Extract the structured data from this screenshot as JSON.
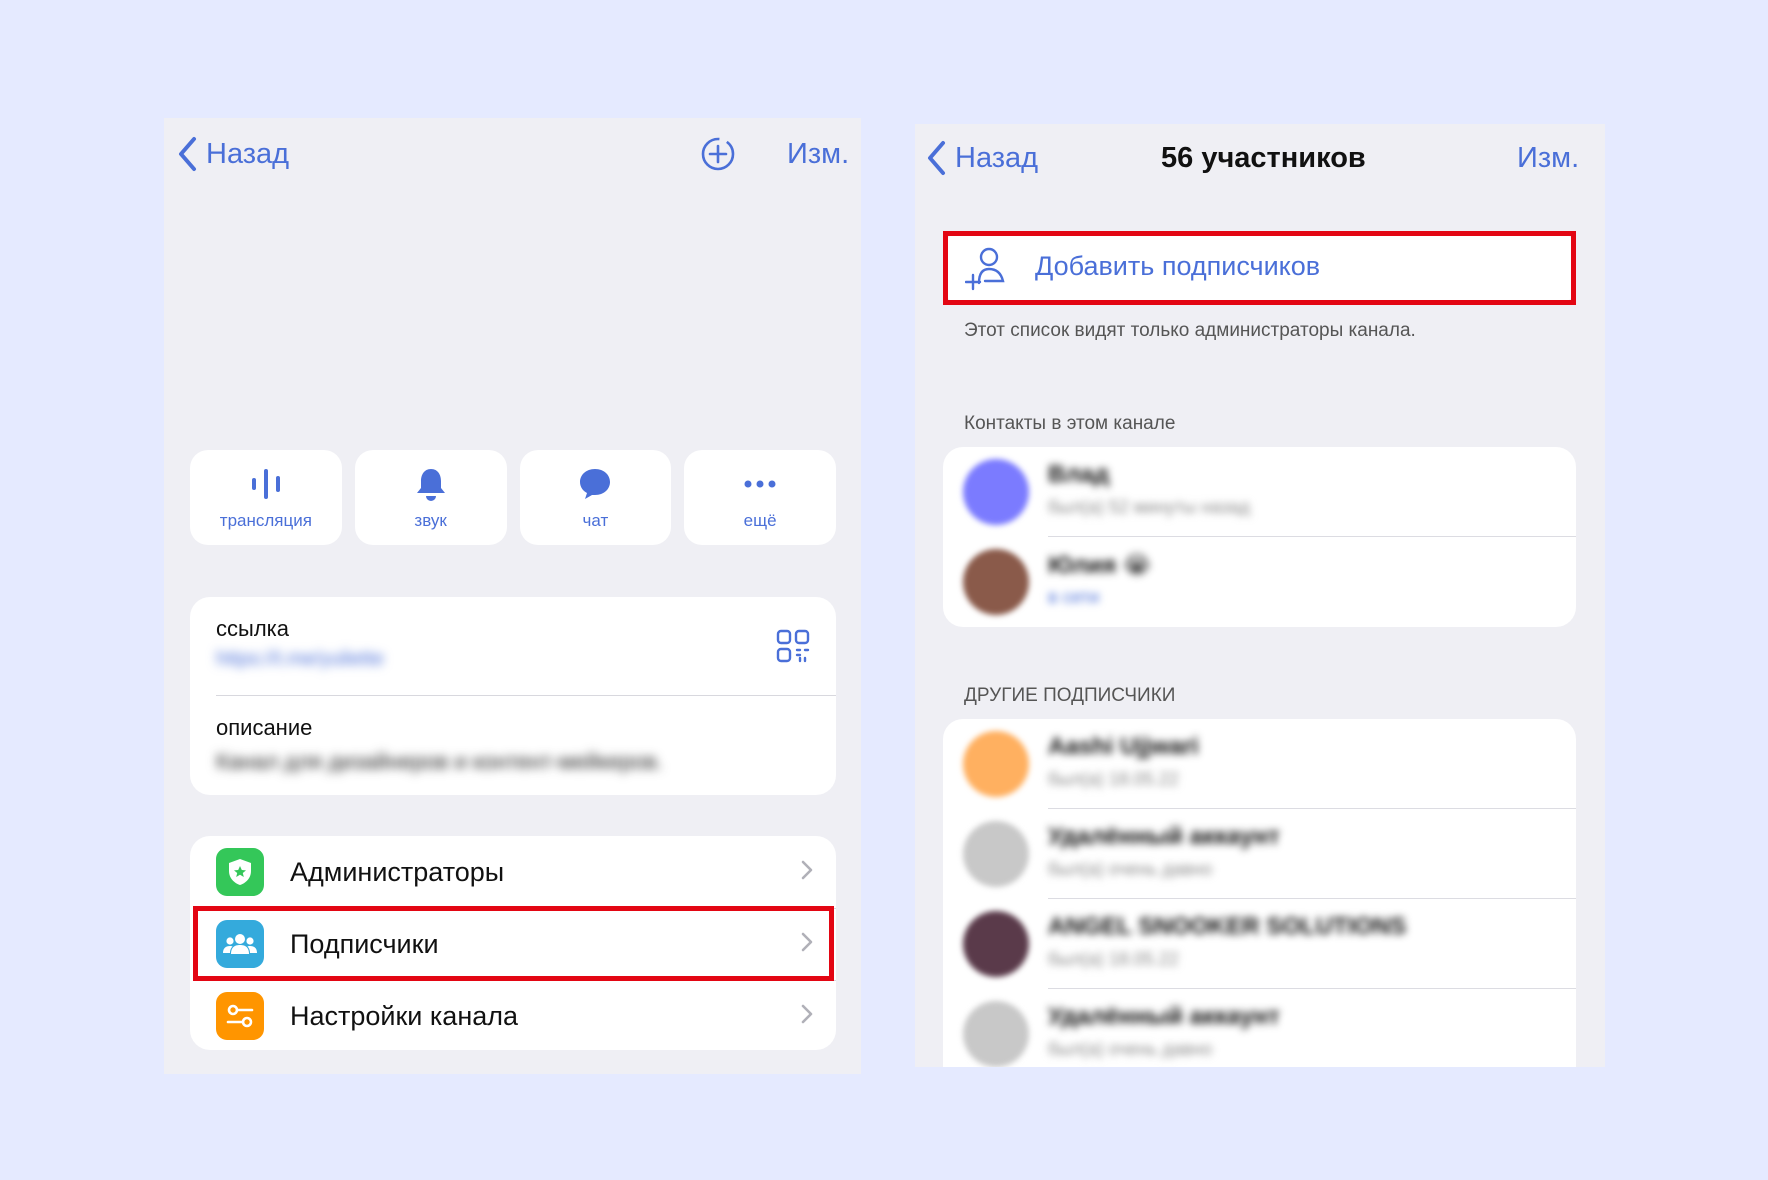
{
  "left_screen": {
    "nav": {
      "back_label": "Назад",
      "edit_label": "Изм.",
      "add_icon": "add-circle-icon"
    },
    "actions": [
      {
        "label": "трансляция",
        "icon": "broadcast-icon"
      },
      {
        "label": "звук",
        "icon": "bell-icon"
      },
      {
        "label": "чат",
        "icon": "chat-bubble-icon"
      },
      {
        "label": "ещё",
        "icon": "more-dots-icon"
      }
    ],
    "info": {
      "link_label": "ссылка",
      "link_value": "https://t.me/yuliette",
      "description_label": "описание",
      "description_value": "Канал для дизайнеров и контент-мейкеров."
    },
    "menu": [
      {
        "label": "Администраторы",
        "icon": "admin-shield-icon",
        "color": "#34c759"
      },
      {
        "label": "Подписчики",
        "icon": "people-icon",
        "color": "#34aadc"
      },
      {
        "label": "Настройки канала",
        "icon": "settings-sliders-icon",
        "color": "#ff9500"
      }
    ]
  },
  "right_screen": {
    "nav": {
      "back_label": "Назад",
      "title": "56 участников",
      "edit_label": "Изм."
    },
    "add_subscribers_label": "Добавить подписчиков",
    "admin_note": "Этот список видят только администраторы канала.",
    "contacts_header": "Контакты в этом канале",
    "contacts": [
      {
        "name": "Влад",
        "status": "был(а) 52 минуты назад",
        "avatar_color": "#7b7bff"
      },
      {
        "name": "Юлия 😭",
        "status": "в сети",
        "avatar_color": "#8a5a4a"
      }
    ],
    "others_header": "ДРУГИЕ ПОДПИСЧИКИ",
    "others": [
      {
        "name": "Aashi Ujjwari",
        "status": "был(а) 18.05.22",
        "avatar_color": "#ffb060"
      },
      {
        "name": "Удалённый аккаунт",
        "status": "был(а) очень давно",
        "avatar_color": "#c8c8c8"
      },
      {
        "name": "ANGEL SNOOKER SOLUTIONS",
        "status": "был(а) 18.05.22",
        "avatar_color": "#5a3a4a"
      },
      {
        "name": "Удалённый аккаунт",
        "status": "был(а) очень давно",
        "avatar_color": "#c8c8c8"
      }
    ]
  }
}
